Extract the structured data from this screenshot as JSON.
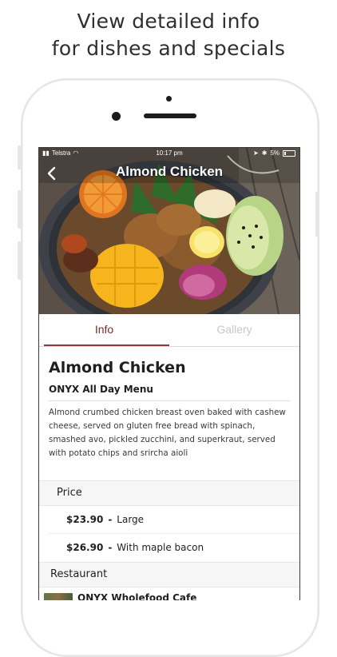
{
  "promo": {
    "line1": "View detailed info",
    "line2": "for dishes and specials"
  },
  "status_bar": {
    "carrier": "Telstra",
    "time": "10:17 pm",
    "battery": "5%"
  },
  "nav": {
    "title": "Almond Chicken",
    "back_icon": "chevron-left-icon"
  },
  "tabs": [
    {
      "label": "Info",
      "active": true
    },
    {
      "label": "Gallery",
      "active": false
    }
  ],
  "dish": {
    "name": "Almond Chicken",
    "menu": "ONYX All Day Menu",
    "description": "Almond crumbed chicken breast oven baked with cashew cheese, served on gluten free bread with spinach, smashed avo, pickled zucchini, and superkraut, served with potato chips and srircha aioli"
  },
  "price_section": {
    "heading": "Price",
    "items": [
      {
        "amount": "$23.90",
        "separator": "-",
        "label": "Large"
      },
      {
        "amount": "$26.90",
        "separator": "-",
        "label": "With maple bacon"
      }
    ]
  },
  "restaurant_section": {
    "heading": "Restaurant",
    "name": "ONYX Wholefood Cafe"
  },
  "colors": {
    "accent": "#7b2d2d",
    "inactive_tab": "#c9c9c9"
  }
}
